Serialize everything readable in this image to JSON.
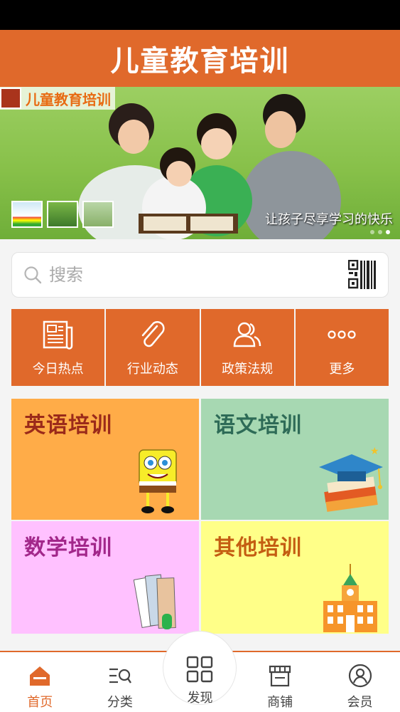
{
  "header": {
    "title": "儿童教育培训"
  },
  "banner": {
    "logo_text": "儿童教育培训",
    "caption": "让孩子尽享学习的快乐",
    "slide_count": 3,
    "active_slide": 3
  },
  "search": {
    "placeholder": "搜索",
    "value": ""
  },
  "quick_nav": [
    {
      "label": "今日热点",
      "icon": "newspaper-icon"
    },
    {
      "label": "行业动态",
      "icon": "paperclip-icon"
    },
    {
      "label": "政策法规",
      "icon": "people-icon"
    },
    {
      "label": "更多",
      "icon": "more-dots-icon"
    }
  ],
  "categories": [
    {
      "label": "英语培训",
      "color": "#ffac48"
    },
    {
      "label": "语文培训",
      "color": "#a7d8b2"
    },
    {
      "label": "数学培训",
      "color": "#ffc1ff"
    },
    {
      "label": "其他培训",
      "color": "#ffff88"
    }
  ],
  "tabs": [
    {
      "label": "首页",
      "icon": "home-icon",
      "active": true
    },
    {
      "label": "分类",
      "icon": "category-search-icon",
      "active": false
    },
    {
      "label": "发现",
      "icon": "grid-icon",
      "active": false
    },
    {
      "label": "商铺",
      "icon": "store-icon",
      "active": false
    },
    {
      "label": "会员",
      "icon": "user-icon",
      "active": false
    }
  ],
  "colors": {
    "accent": "#e0692b"
  }
}
